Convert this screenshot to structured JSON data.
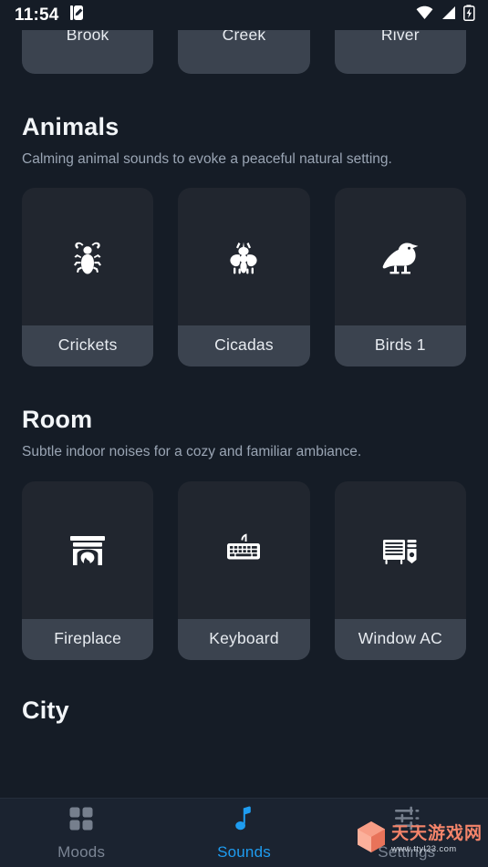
{
  "status_bar": {
    "time": "11:54",
    "icons": [
      "note-edit-icon",
      "wifi-icon",
      "cellular-signal-icon",
      "battery-charging-icon"
    ]
  },
  "clipped_row": {
    "cards": [
      {
        "label": "Brook"
      },
      {
        "label": "Creek"
      },
      {
        "label": "River"
      }
    ]
  },
  "sections": [
    {
      "title": "Animals",
      "description": "Calming animal sounds to evoke a peaceful natural setting.",
      "cards": [
        {
          "label": "Crickets",
          "icon": "cricket-icon"
        },
        {
          "label": "Cicadas",
          "icon": "cicada-icon"
        },
        {
          "label": "Birds 1",
          "icon": "bird-icon"
        }
      ]
    },
    {
      "title": "Room",
      "description": "Subtle indoor noises for a cozy and familiar ambiance.",
      "cards": [
        {
          "label": "Fireplace",
          "icon": "fireplace-icon"
        },
        {
          "label": "Keyboard",
          "icon": "keyboard-icon"
        },
        {
          "label": "Window AC",
          "icon": "window-ac-icon"
        }
      ]
    }
  ],
  "next_section_title": "City",
  "bottom_nav": {
    "items": [
      {
        "label": "Moods",
        "icon": "grid-icon",
        "active": false
      },
      {
        "label": "Sounds",
        "icon": "music-note-icon",
        "active": true
      },
      {
        "label": "Settings",
        "icon": "sliders-icon",
        "active": false
      }
    ]
  },
  "watermark": {
    "main": "天天游戏网",
    "sub": "www.ttyl23.com",
    "logo": "hexagon-logo"
  },
  "colors": {
    "background": "#151c26",
    "card": "#21262f",
    "card_label": "#3b434f",
    "accent": "#1e9cf0",
    "text_primary": "#f2f5f8",
    "text_secondary": "#9aa5b4",
    "nav_inactive": "#7b8594",
    "watermark_orange": "#f4846a"
  }
}
